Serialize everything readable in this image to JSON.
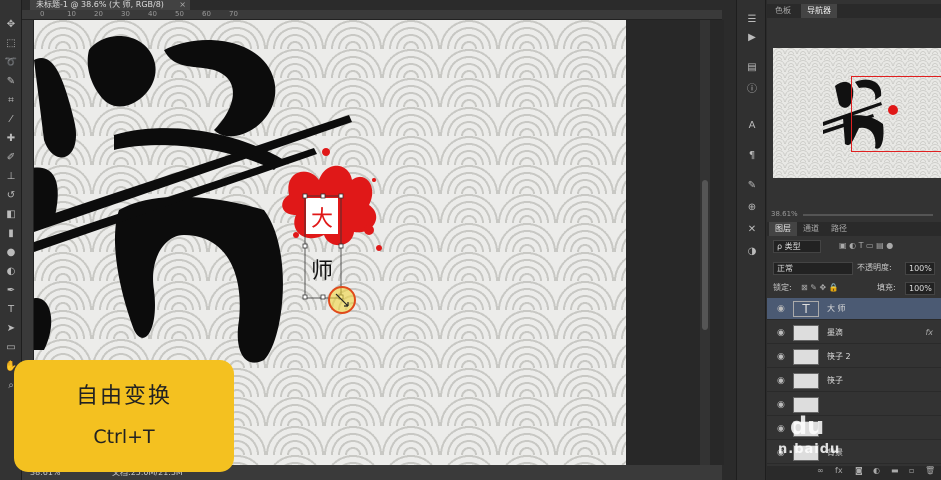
{
  "document": {
    "tab_title": "未标题-1 @ 38.6% (大 师, RGB/8)",
    "close_glyph": "×"
  },
  "ruler": {
    "ticks": [
      "0",
      "10",
      "20",
      "30",
      "40",
      "50",
      "60",
      "70"
    ]
  },
  "toolbar": {
    "tools": [
      {
        "name": "move-tool-icon",
        "glyph": "✥"
      },
      {
        "name": "marquee-tool-icon",
        "glyph": "⬚"
      },
      {
        "name": "lasso-tool-icon",
        "glyph": "➰"
      },
      {
        "name": "quick-select-tool-icon",
        "glyph": "✎"
      },
      {
        "name": "crop-tool-icon",
        "glyph": "⌗"
      },
      {
        "name": "eyedropper-tool-icon",
        "glyph": "⁄"
      },
      {
        "name": "healing-tool-icon",
        "glyph": "✚"
      },
      {
        "name": "brush-tool-icon",
        "glyph": "✐"
      },
      {
        "name": "stamp-tool-icon",
        "glyph": "⊥"
      },
      {
        "name": "history-brush-tool-icon",
        "glyph": "↺"
      },
      {
        "name": "eraser-tool-icon",
        "glyph": "◧"
      },
      {
        "name": "gradient-tool-icon",
        "glyph": "▮"
      },
      {
        "name": "blur-tool-icon",
        "glyph": "●"
      },
      {
        "name": "dodge-tool-icon",
        "glyph": "◐"
      },
      {
        "name": "pen-tool-icon",
        "glyph": "✒"
      },
      {
        "name": "type-tool-icon",
        "glyph": "T"
      },
      {
        "name": "path-select-tool-icon",
        "glyph": "➤"
      },
      {
        "name": "shape-tool-icon",
        "glyph": "▭"
      },
      {
        "name": "hand-tool-icon",
        "glyph": "✋"
      },
      {
        "name": "zoom-tool-icon",
        "glyph": "⌕"
      }
    ]
  },
  "canvas": {
    "stamp_chars": [
      "大",
      "师"
    ]
  },
  "status": {
    "zoom": "38.61%",
    "doc_info": "文档:25.0M/21.5M"
  },
  "callout": {
    "title": "自由变换",
    "shortcut": "Ctrl+T"
  },
  "panels": {
    "top_tabs": [
      "色板",
      "导航器"
    ],
    "nav_zoom": "38.61%",
    "layer_tabs": [
      "图层",
      "通道",
      "路径"
    ],
    "filter_label": "ρ 类型",
    "blend_mode": "正常",
    "opacity_label": "不透明度:",
    "opacity_value": "100%",
    "lock_label": "锁定:",
    "fill_label": "填充:",
    "fill_value": "100%",
    "layers": [
      {
        "name": "大 师",
        "type": "text",
        "selected": true,
        "fx": ""
      },
      {
        "name": "墨滴",
        "type": "image",
        "selected": false,
        "fx": "fx"
      },
      {
        "name": "筷子 2",
        "type": "image",
        "selected": false,
        "fx": ""
      },
      {
        "name": "筷子",
        "type": "image",
        "selected": false,
        "fx": ""
      },
      {
        "name": "",
        "type": "image",
        "selected": false,
        "fx": ""
      },
      {
        "name": "",
        "type": "image",
        "selected": false,
        "fx": ""
      },
      {
        "name": "背景",
        "type": "image",
        "selected": false,
        "fx": ""
      }
    ]
  },
  "watermark": {
    "logo": "du",
    "site": "n.baidu"
  },
  "colors": {
    "accent_yellow": "#f4c120",
    "stamp_red": "#e01818",
    "selection_blue": "#4b5a73"
  }
}
